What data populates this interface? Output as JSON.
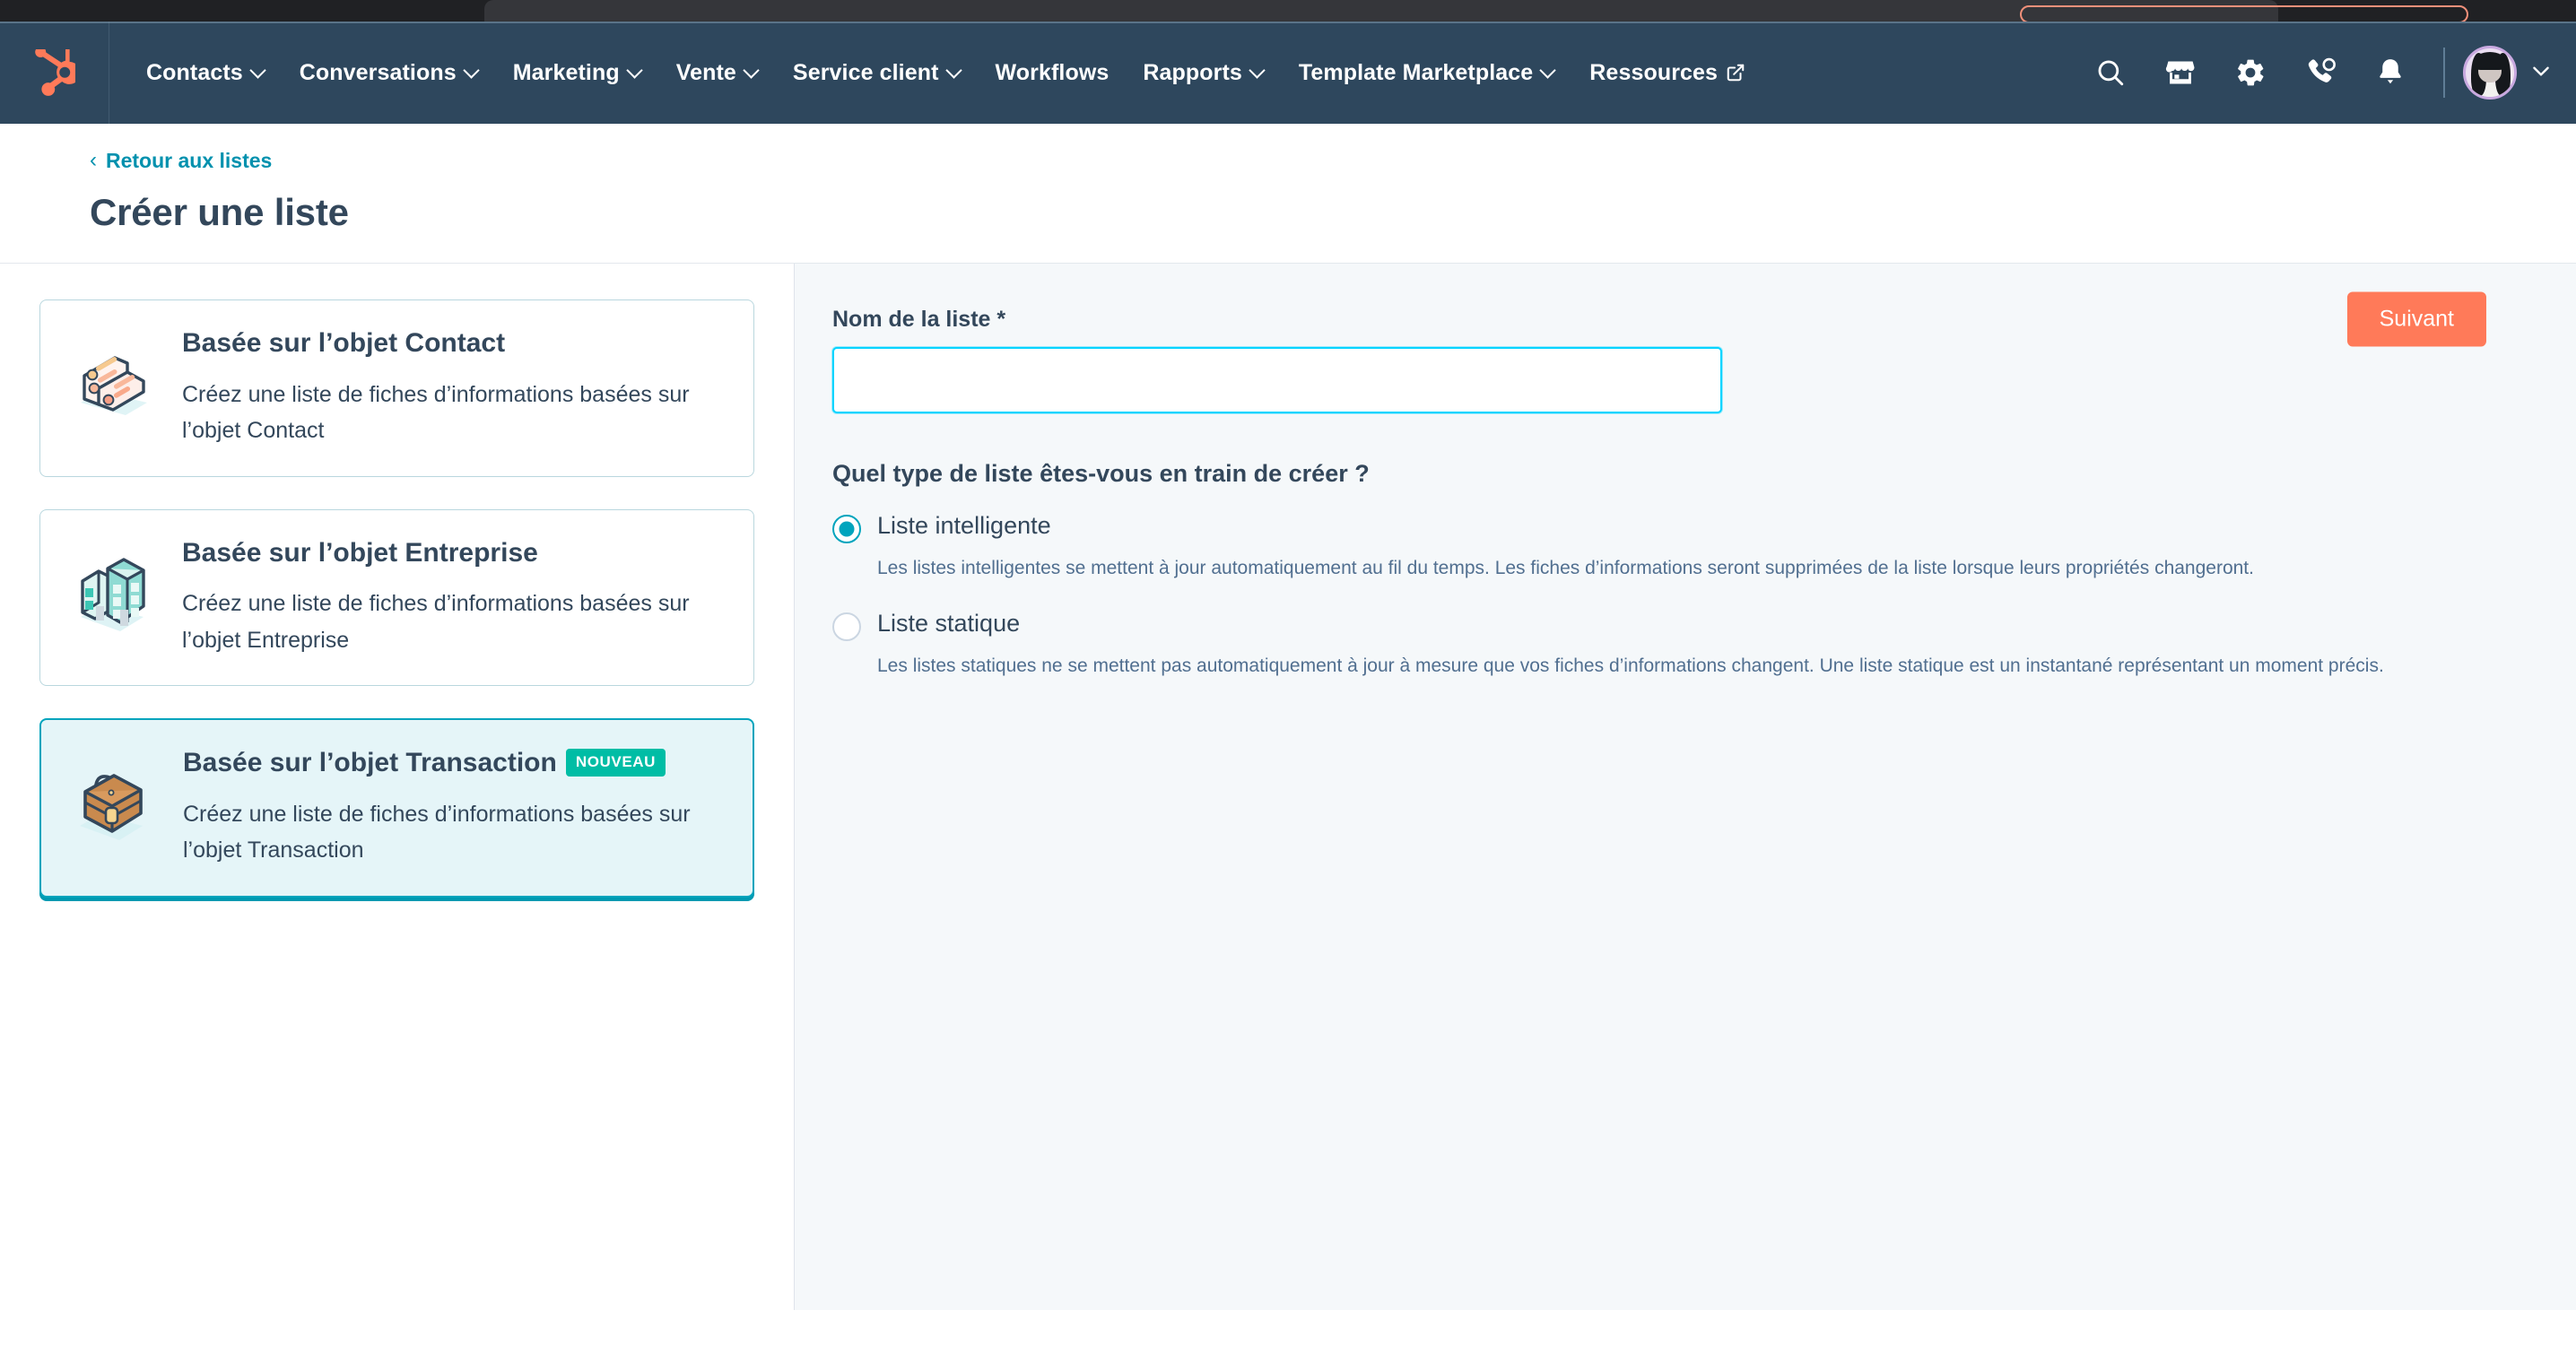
{
  "navbar": {
    "logo_name": "hubspot-logo",
    "menu": [
      {
        "label": "Contacts",
        "has_caret": true,
        "external": false
      },
      {
        "label": "Conversations",
        "has_caret": true,
        "external": false
      },
      {
        "label": "Marketing",
        "has_caret": true,
        "external": false
      },
      {
        "label": "Vente",
        "has_caret": true,
        "external": false
      },
      {
        "label": "Service client",
        "has_caret": true,
        "external": false
      },
      {
        "label": "Workflows",
        "has_caret": false,
        "external": false
      },
      {
        "label": "Rapports",
        "has_caret": true,
        "external": false
      },
      {
        "label": "Template Marketplace",
        "has_caret": true,
        "external": false
      },
      {
        "label": "Ressources",
        "has_caret": false,
        "external": true
      }
    ],
    "icons": [
      "search-icon",
      "marketplace-icon",
      "settings-gear-icon",
      "calling-icon",
      "notifications-bell-icon"
    ],
    "avatar_name": "user-avatar"
  },
  "header": {
    "back_link": "Retour aux listes",
    "title": "Créer une liste",
    "next_button": "Suivant"
  },
  "object_cards": [
    {
      "title": "Basée sur l’objet Contact",
      "description": "Créez une liste de fiches d’informations basées sur l’objet Contact",
      "icon": "contact-book-icon",
      "badge": "",
      "selected": false
    },
    {
      "title": "Basée sur l’objet Entreprise",
      "description": "Créez une liste de fiches d’informations basées sur l’objet Entreprise",
      "icon": "office-building-icon",
      "badge": "",
      "selected": false
    },
    {
      "title": "Basée sur l’objet Transaction",
      "description": "Créez une liste de fiches d’informations basées sur l’objet Transaction",
      "icon": "briefcase-icon",
      "badge": "NOUVEAU",
      "selected": true
    }
  ],
  "form": {
    "name_label": "Nom de la liste *",
    "name_value": "",
    "name_placeholder": "",
    "question": "Quel type de liste êtes-vous en train de créer ?",
    "options": [
      {
        "label": "Liste intelligente",
        "description": "Les listes intelligentes se mettent à jour automatiquement au fil du temps. Les fiches d’informations seront supprimées de la liste lorsque leurs propriétés changeront.",
        "selected": true
      },
      {
        "label": "Liste statique",
        "description": "Les listes statiques ne se mettent pas automatiquement à jour à mesure que vos fiches d’informations changent. Une liste statique est un instantané représentant un moment précis.",
        "selected": false
      }
    ]
  },
  "colors": {
    "navbar_bg": "#2e475d",
    "accent_orange": "#ff7a59",
    "accent_teal": "#00a4bd",
    "badge_green": "#00bda5",
    "link_blue": "#0091ae",
    "panel_bg": "#f5f8fa",
    "text_dark": "#33475b",
    "text_muted": "#516f90",
    "focus_border": "#00d4ff"
  }
}
